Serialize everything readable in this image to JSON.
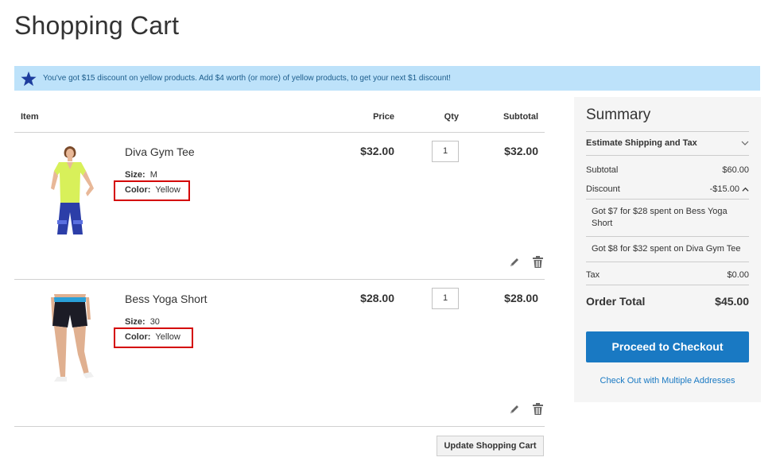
{
  "page": {
    "title": "Shopping Cart"
  },
  "promo": {
    "message": "You've got $15 discount on yellow products. Add $4 worth (or more) of yellow products, to get your next $1 discount!"
  },
  "cart": {
    "headers": {
      "item": "Item",
      "price": "Price",
      "qty": "Qty",
      "subtotal": "Subtotal"
    },
    "items": [
      {
        "name": "Diva Gym Tee",
        "size_label": "Size:",
        "size": "M",
        "color_label": "Color:",
        "color": "Yellow",
        "price": "$32.00",
        "qty": "1",
        "subtotal": "$32.00",
        "image": "yellow-tee-product-photo"
      },
      {
        "name": "Bess Yoga Short",
        "size_label": "Size:",
        "size": "30",
        "color_label": "Color:",
        "color": "Yellow",
        "price": "$28.00",
        "qty": "1",
        "subtotal": "$28.00",
        "image": "black-yoga-shorts-product-photo"
      }
    ],
    "update_button": "Update Shopping Cart"
  },
  "summary": {
    "title": "Summary",
    "estimate_shipping": "Estimate Shipping and Tax",
    "subtotal_label": "Subtotal",
    "subtotal": "$60.00",
    "discount_label": "Discount",
    "discount": "-$15.00",
    "discount_details": [
      "Got $7 for $28 spent on Bess Yoga Short",
      "Got $8 for $32 spent on Diva Gym Tee"
    ],
    "tax_label": "Tax",
    "tax": "$0.00",
    "order_total_label": "Order Total",
    "order_total": "$45.00",
    "checkout_button": "Proceed to Checkout",
    "multi_address_link": "Check Out with Multiple Addresses"
  },
  "colors": {
    "accent": "#1979c3",
    "promo_bg": "#bde2fa",
    "highlight": "#d40000"
  }
}
